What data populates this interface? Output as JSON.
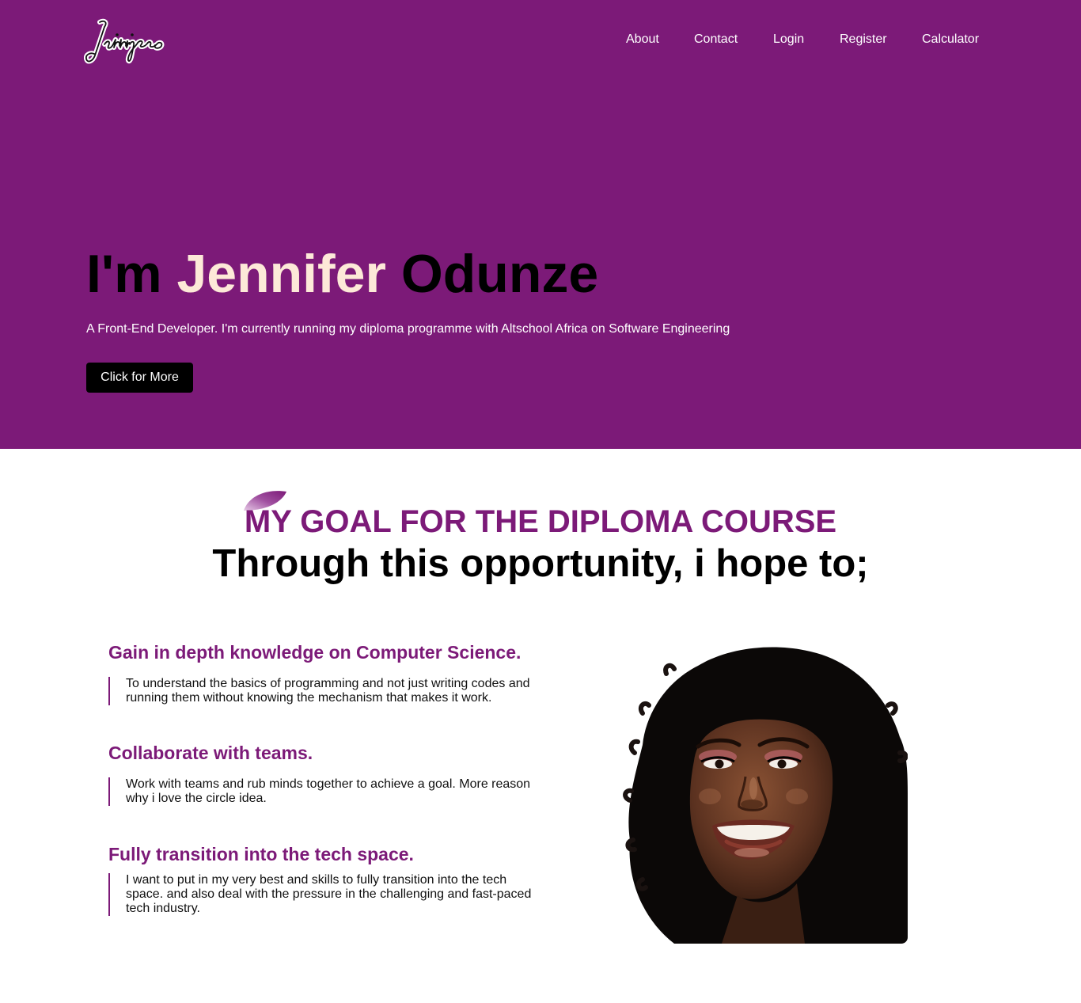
{
  "header": {
    "logo_text": "Jennifer",
    "nav": [
      "About",
      "Contact",
      "Login",
      "Register",
      "Calculator"
    ]
  },
  "hero": {
    "title_prefix": "I'm",
    "title_first": "Jennifer",
    "title_last": "Odunze",
    "subtitle": "A Front-End Developer. I'm currently running my diploma programme with Altschool Africa on Software Engineering",
    "button_label": "Click for More"
  },
  "goals": {
    "title": "MY GOAL FOR THE DIPLOMA COURSE",
    "subtitle": "Through this opportunity, i hope to;",
    "items": [
      {
        "heading": "Gain in depth knowledge on Computer Science.",
        "text": "To understand the basics of programming and not just writing codes and running them without knowing the mechanism that makes it work."
      },
      {
        "heading": "Collaborate with teams.",
        "text": "Work with teams and rub minds together to achieve a goal. More reason why i love the circle idea."
      },
      {
        "heading": "Fully transition into the tech space.",
        "text": "I want to put in my very best and skills to fully transition into the tech space. and also deal with the pressure in the challenging and fast-paced tech industry."
      }
    ]
  },
  "colors": {
    "brand_purple": "#7c1a78",
    "title_highlight": "#fde9d8",
    "button_bg": "#000000"
  }
}
